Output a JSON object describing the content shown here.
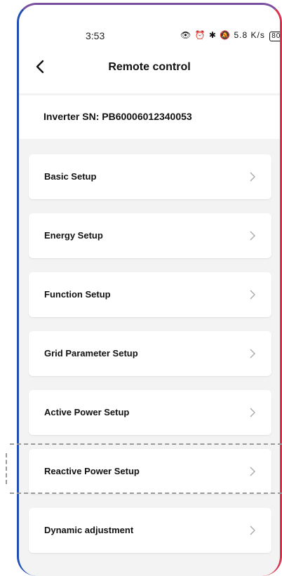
{
  "status_bar": {
    "time": "3:53",
    "icons_text": "👁 ⏰ ✱ 🔕 5.8 K/s",
    "battery": "80"
  },
  "header": {
    "title": "Remote control"
  },
  "inverter": {
    "sn_label": "Inverter SN: PB60006012340053"
  },
  "menu": [
    {
      "label": "Basic Setup"
    },
    {
      "label": "Energy Setup"
    },
    {
      "label": "Function Setup"
    },
    {
      "label": "Grid Parameter Setup"
    },
    {
      "label": "Active Power Setup"
    },
    {
      "label": "Reactive Power Setup"
    },
    {
      "label": "Dynamic adjustment"
    }
  ],
  "colors": {
    "accent_top": "#7a4fa0",
    "accent_left": "#1f4fb5",
    "accent_right": "#d8324c",
    "background": "#f3f3f3"
  }
}
